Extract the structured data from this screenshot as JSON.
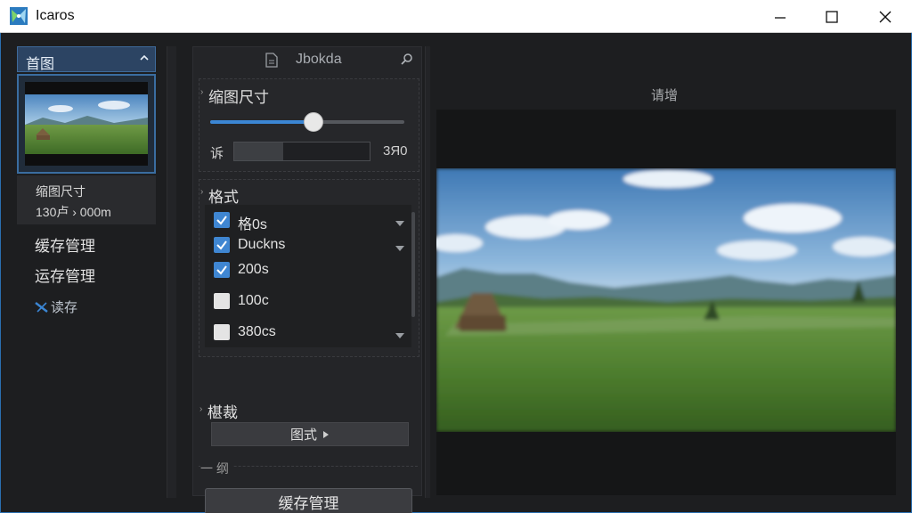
{
  "window": {
    "title": "Icaros",
    "icon": "icaros-app-icon",
    "controls": [
      "minimize-icon",
      "maximize-icon",
      "close-icon"
    ]
  },
  "sidebar": {
    "header": "首图",
    "thumbnail_info": {
      "line1": "缩图尺寸",
      "line2": "130卢 › 000m"
    },
    "items": [
      {
        "label": "缓存管理"
      },
      {
        "label": "运存管理"
      },
      {
        "label": "读存",
        "icon": "tools-icon"
      }
    ]
  },
  "mid_panel": {
    "search": {
      "value": "Jbokda",
      "icons": [
        "document-icon",
        "search-icon"
      ]
    },
    "size_section": {
      "title": "缩图尺寸",
      "slider_fraction": 0.53,
      "size_label": "诉",
      "size_fill_fraction": 0.36,
      "size_value": "3Я0"
    },
    "format_section": {
      "title": "格式",
      "items": [
        {
          "label": "格0s",
          "checked": true,
          "has_arrow": true
        },
        {
          "label": "Duckns",
          "checked": true,
          "has_arrow": true
        },
        {
          "label": "200s",
          "checked": true,
          "has_arrow": false
        },
        {
          "label": "100c",
          "checked": false,
          "has_arrow": false
        },
        {
          "label": "380cs",
          "checked": false,
          "has_arrow": true
        }
      ]
    },
    "crop_section": {
      "title": "椹裁",
      "button_label": "图式"
    },
    "divider_label": "一 纲",
    "cache_button": "缓存管理"
  },
  "preview": {
    "title": "请增"
  },
  "colors": {
    "accent": "#3b86d4",
    "titlebar": "#ffffff",
    "background": "#1d1e20"
  }
}
